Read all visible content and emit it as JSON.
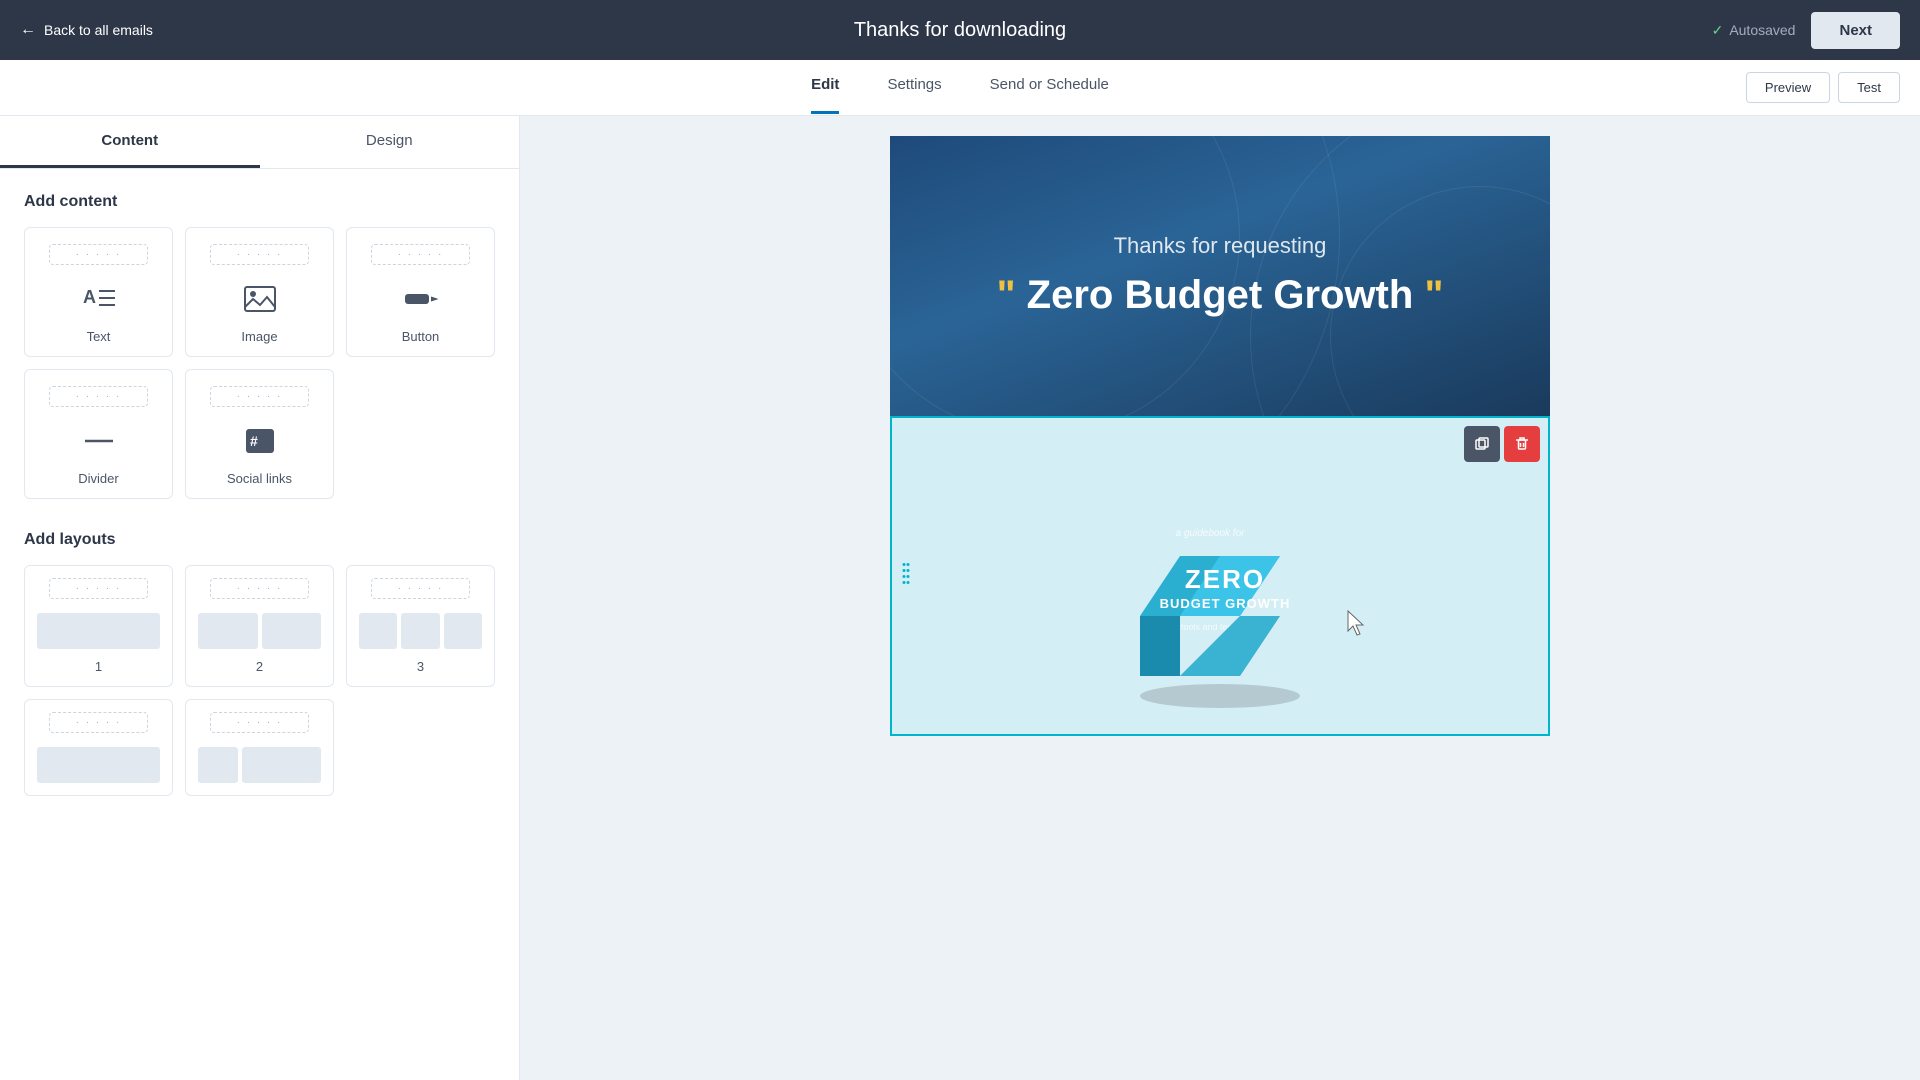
{
  "topNav": {
    "backLabel": "Back to all emails",
    "title": "Thanks for downloading",
    "autosavedLabel": "Autosaved",
    "nextLabel": "Next"
  },
  "subNav": {
    "tabs": [
      {
        "id": "edit",
        "label": "Edit",
        "active": true
      },
      {
        "id": "settings",
        "label": "Settings",
        "active": false
      },
      {
        "id": "send-schedule",
        "label": "Send or Schedule",
        "active": false
      }
    ],
    "previewLabel": "Preview",
    "testLabel": "Test"
  },
  "sidebar": {
    "contentTab": "Content",
    "designTab": "Design",
    "addContentTitle": "Add content",
    "contentBlocks": [
      {
        "id": "text",
        "label": "Text",
        "icon": "text"
      },
      {
        "id": "image",
        "label": "Image",
        "icon": "image"
      },
      {
        "id": "button",
        "label": "Button",
        "icon": "button"
      },
      {
        "id": "divider",
        "label": "Divider",
        "icon": "divider"
      },
      {
        "id": "social",
        "label": "Social links",
        "icon": "social"
      }
    ],
    "addLayoutsTitle": "Add layouts",
    "layouts": [
      {
        "id": "1",
        "label": "1",
        "cols": 1
      },
      {
        "id": "2",
        "label": "2",
        "cols": 2
      },
      {
        "id": "3",
        "label": "3",
        "cols": 3
      }
    ]
  },
  "emailPreview": {
    "headerSubtitle": "Thanks for requesting",
    "headerTitle": "\" Zero Budget Growth \"",
    "bookAlt": "Zero Budget Growth book"
  }
}
